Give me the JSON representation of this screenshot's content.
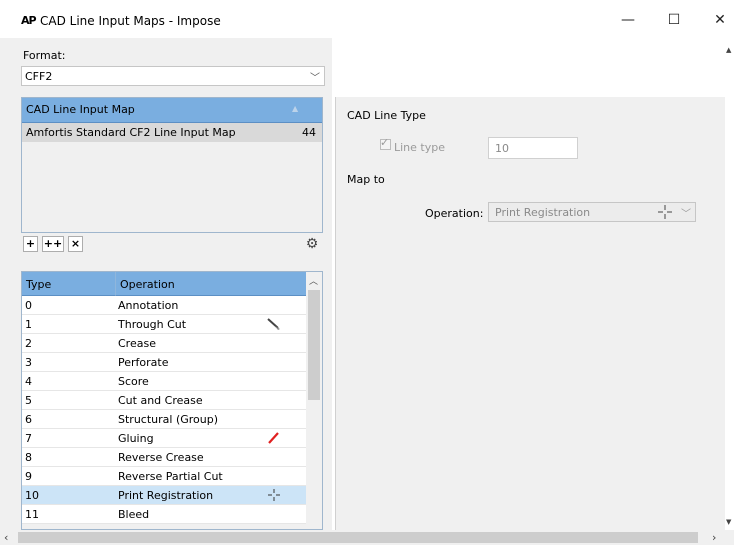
{
  "window": {
    "logo": "AP",
    "title": "CAD Line Input Maps - Impose",
    "minimize": "—",
    "maximize": "☐",
    "close": "✕"
  },
  "format": {
    "label": "Format:",
    "value": "CFF2"
  },
  "maps": {
    "header": "CAD Line Input Map",
    "items": [
      {
        "name": "Amfortis Standard CF2 Line Input Map",
        "count": "44"
      }
    ]
  },
  "toolbar": {
    "add": "+",
    "add_multiple": "++",
    "delete": "×"
  },
  "types_table": {
    "col_type": "Type",
    "col_operation": "Operation",
    "rows": [
      {
        "type": "0",
        "operation": "Annotation",
        "icon": ""
      },
      {
        "type": "1",
        "operation": "Through Cut",
        "icon": "knife-icon"
      },
      {
        "type": "2",
        "operation": "Crease",
        "icon": ""
      },
      {
        "type": "3",
        "operation": "Perforate",
        "icon": ""
      },
      {
        "type": "4",
        "operation": "Score",
        "icon": ""
      },
      {
        "type": "5",
        "operation": "Cut and Crease",
        "icon": ""
      },
      {
        "type": "6",
        "operation": "Structural (Group)",
        "icon": ""
      },
      {
        "type": "7",
        "operation": "Gluing",
        "icon": "glue-line-icon"
      },
      {
        "type": "8",
        "operation": "Reverse Crease",
        "icon": ""
      },
      {
        "type": "9",
        "operation": "Reverse Partial Cut",
        "icon": ""
      },
      {
        "type": "10",
        "operation": "Print Registration",
        "icon": "registration-mark-icon"
      },
      {
        "type": "11",
        "operation": "Bleed",
        "icon": ""
      }
    ],
    "selected_type": "10"
  },
  "details": {
    "section_title": "CAD Line Type",
    "line_type_label": "Line type",
    "line_type_checked": true,
    "line_type_value": "10",
    "map_to_label": "Map to",
    "operation_label": "Operation:",
    "operation_value": "Print Registration"
  },
  "colors": {
    "header_blue": "#7aaee0",
    "selected_row": "#cce4f7",
    "glue_red": "#e02020"
  }
}
